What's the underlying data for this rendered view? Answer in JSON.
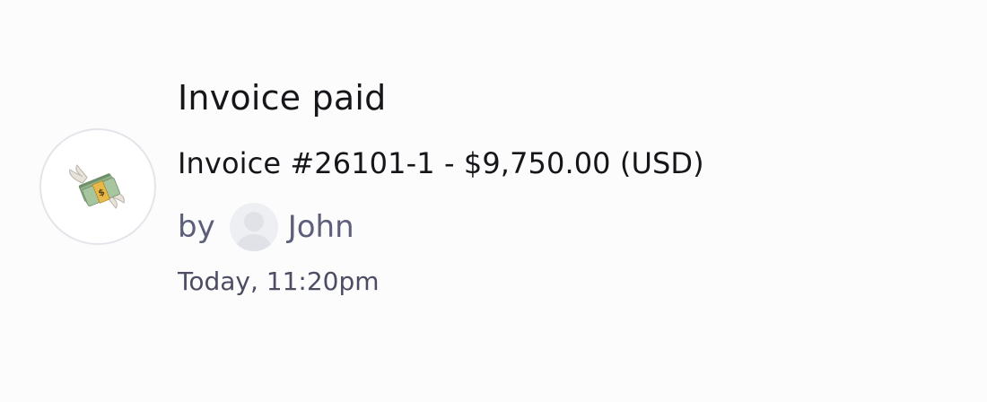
{
  "activity": {
    "icon": "money-with-wings-icon",
    "title": "Invoice paid",
    "description": "Invoice #26101-1 - $9,750.00 (USD)",
    "author": {
      "prefix": "by",
      "name": "John",
      "avatar_icon": "user-avatar-placeholder-icon"
    },
    "timestamp": "Today, 11:20pm"
  },
  "colors": {
    "title": "#16161a",
    "meta": "#5d5f7a",
    "icon_border": "#e4e4ea",
    "avatar_bg": "#eeeff2"
  }
}
